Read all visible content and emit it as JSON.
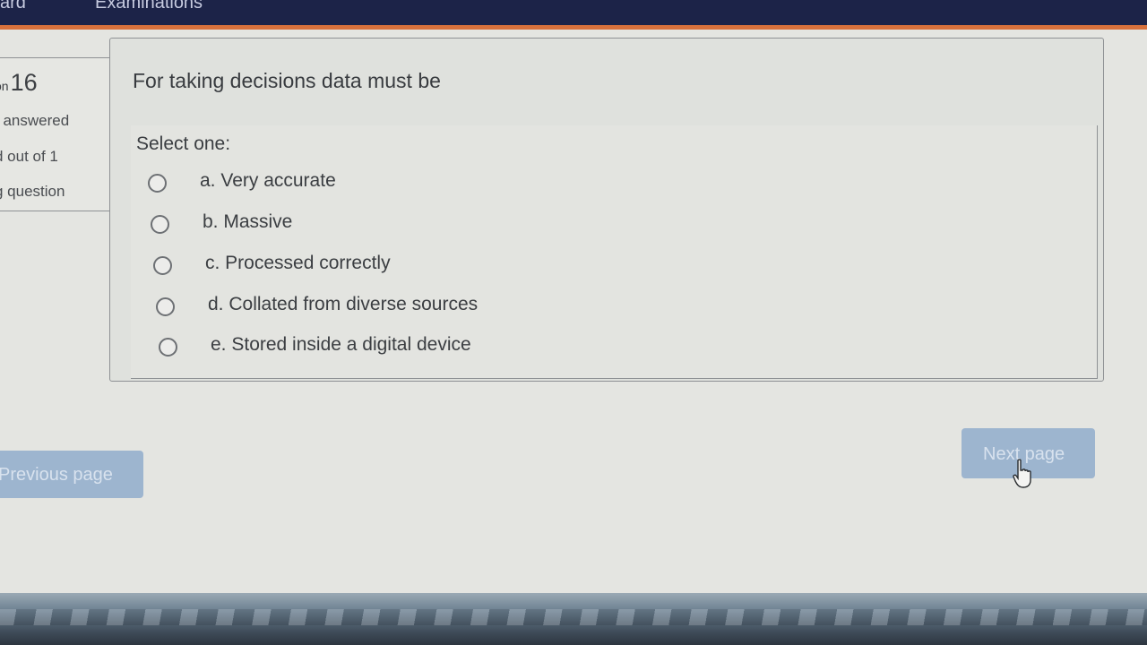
{
  "nav": {
    "item1": "ard",
    "item2": "Examinations"
  },
  "question_info": {
    "number_prefix": "on",
    "number": "16",
    "status": "t answered",
    "marks": "d out of 1",
    "flag": "g question"
  },
  "question": {
    "text": "For taking decisions data must be",
    "select_label": "Select one:",
    "options": [
      {
        "label": "a. Very accurate",
        "selected": false
      },
      {
        "label": "b. Massive",
        "selected": false
      },
      {
        "label": "c. Processed correctly",
        "selected": false
      },
      {
        "label": "d. Collated from diverse sources",
        "selected": false
      },
      {
        "label": "e. Stored inside a digital device",
        "selected": false
      }
    ]
  },
  "navigation": {
    "previous_label": "Previous page",
    "next_label": "Next page"
  },
  "colors": {
    "header_bg": "#1c2348",
    "header_accent": "#d8713c",
    "button_bg": "#9db5cf"
  }
}
